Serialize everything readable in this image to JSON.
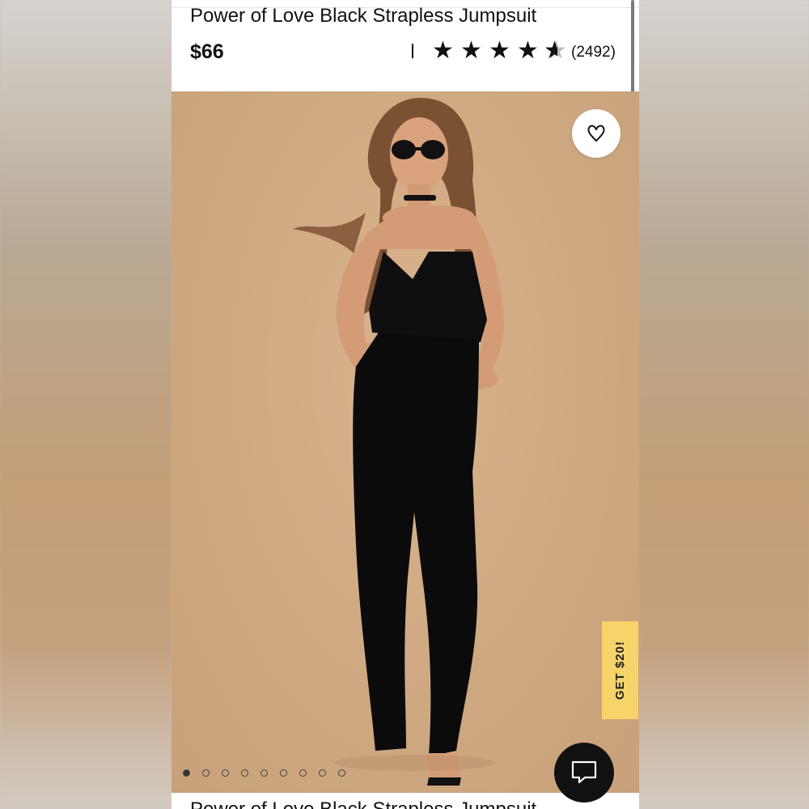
{
  "product": {
    "title": "Power of Love Black Strapless Jumpsuit",
    "price": "$66",
    "rating": 4.5,
    "review_count": "(2492)"
  },
  "promo": {
    "label": "GET $20!"
  },
  "carousel": {
    "total_images": 9,
    "active_index": 0
  },
  "icons": {
    "wishlist": "heart-icon",
    "chat": "chat-bubble-icon",
    "rating": "star-icon"
  },
  "colors": {
    "promo_bg": "#f7d46a",
    "text": "#111111",
    "photo_bg": "#d0aa84"
  }
}
